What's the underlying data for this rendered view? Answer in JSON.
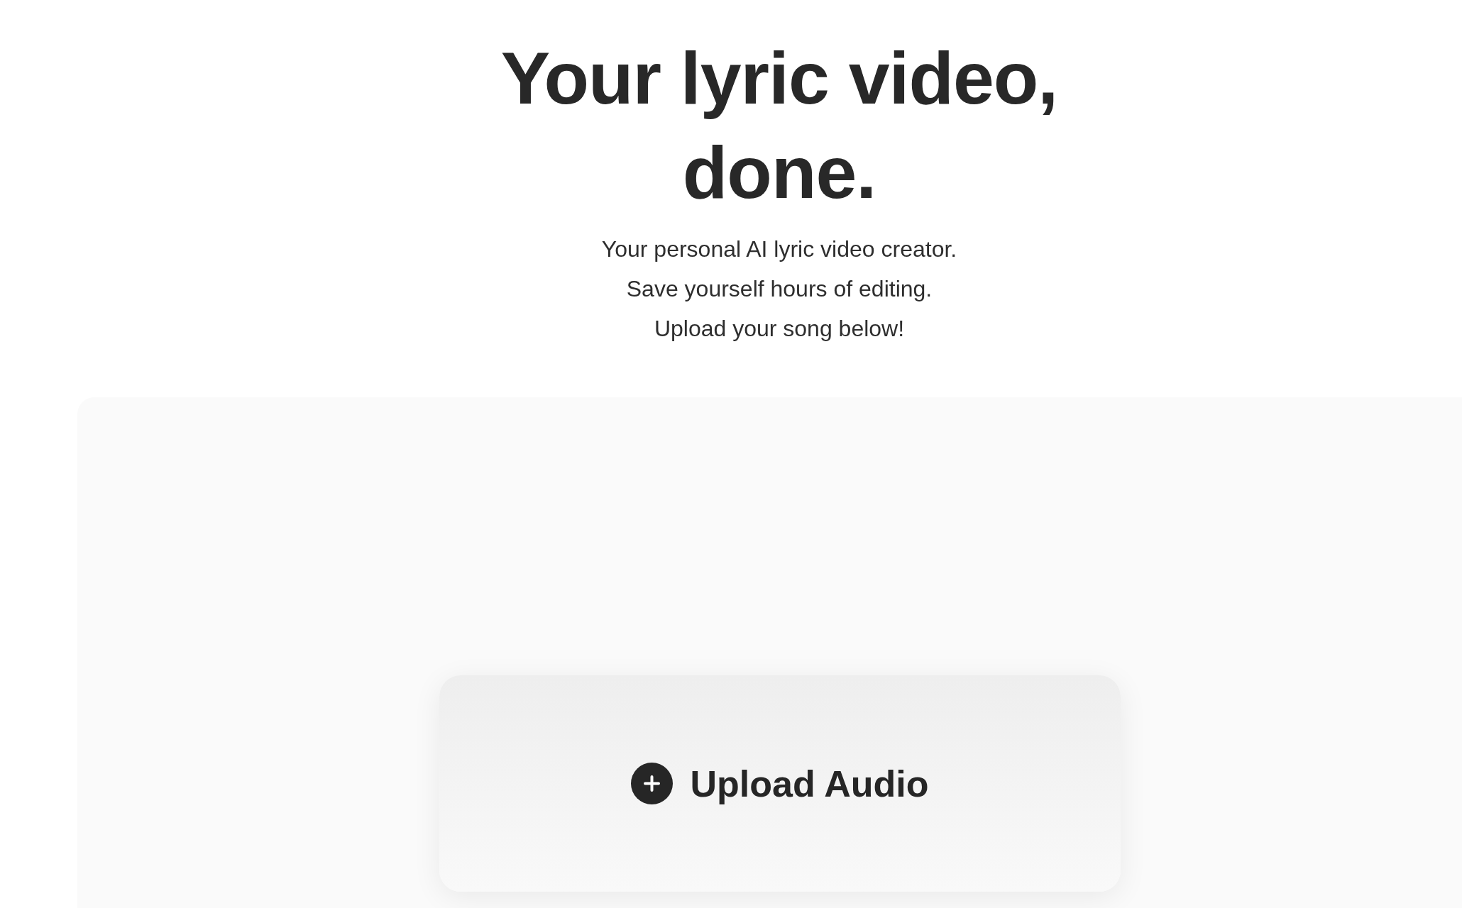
{
  "hero": {
    "title": "Your lyric video, done.",
    "subtitle_lines": [
      "Your personal AI lyric video creator.",
      "Save yourself hours of editing.",
      "Upload your song below!"
    ]
  },
  "upload_panel": {
    "button": {
      "label": "Upload Audio"
    }
  }
}
